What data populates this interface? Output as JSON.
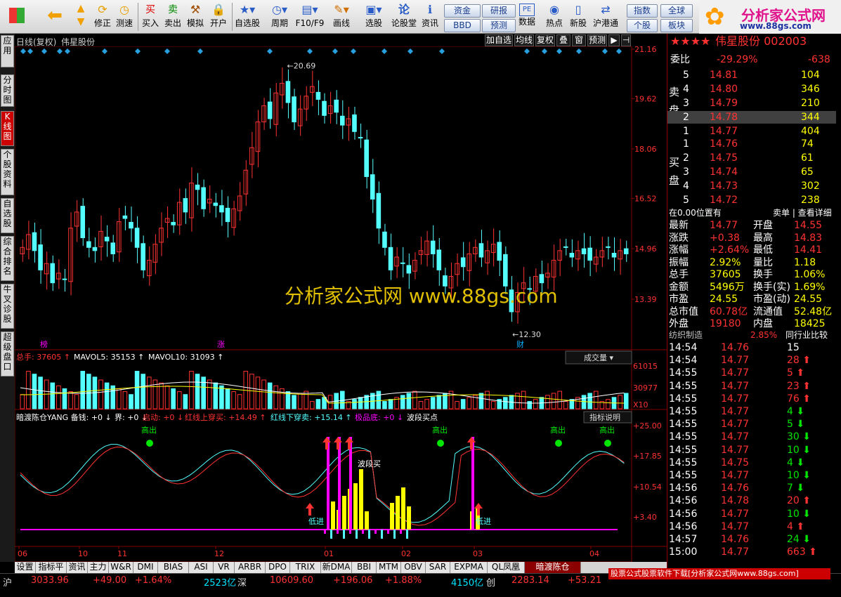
{
  "toolbar": {
    "items": [
      {
        "id": "buy",
        "label": "买入",
        "icon": "买"
      },
      {
        "id": "sell",
        "label": "卖出",
        "icon": "卖"
      },
      {
        "id": "sim",
        "label": "模拟",
        "icon": "hammer-icon"
      },
      {
        "id": "open",
        "label": "开户",
        "icon": "lock-icon"
      },
      {
        "id": "self",
        "label": "自选股",
        "icon": "star-icon"
      },
      {
        "id": "period",
        "label": "周期",
        "icon": "clock-icon"
      },
      {
        "id": "f10",
        "label": "F10/F9",
        "icon": "doc-icon"
      },
      {
        "id": "draw",
        "label": "画线",
        "icon": "pen-icon"
      },
      {
        "id": "pick",
        "label": "选股",
        "icon": "monitor-icon"
      },
      {
        "id": "forum",
        "label": "论股堂",
        "icon": "论"
      },
      {
        "id": "info",
        "label": "资讯",
        "icon": "info-icon"
      },
      {
        "id": "data",
        "label": "数据",
        "icon": "PE"
      },
      {
        "id": "hot",
        "label": "热点",
        "icon": "hot-icon"
      },
      {
        "id": "newstock",
        "label": "新股",
        "icon": "phone-icon"
      },
      {
        "id": "hk",
        "label": "沪港通",
        "icon": "hk-icon"
      }
    ],
    "nav": {
      "back": "back-icon",
      "fix": "修正",
      "speed": "测速"
    },
    "btns": {
      "fund": "资金",
      "report": "研报",
      "bbd": "BBD",
      "forecast": "预测",
      "index": "指数",
      "global": "全球",
      "stock": "个股",
      "sector": "板块"
    }
  },
  "logo": {
    "line1": "分析家公式网",
    "line2": "www.88gs.com"
  },
  "lefttabs": [
    "应用",
    "分时图",
    "K线图",
    "个股资料",
    "自选股",
    "综合排名",
    "牛叉诊股",
    "超级盘口"
  ],
  "chart": {
    "title": "日线(复权)",
    "name": "伟星股份",
    "buttons": [
      "加自选",
      "均线",
      "复权",
      "叠",
      "窗",
      "预测"
    ],
    "price_ticks": [
      "21.16",
      "19.62",
      "18.06",
      "16.52",
      "14.96",
      "13.39"
    ],
    "max_label": "20.69",
    "min_label": "12.30",
    "month_labels": [
      "06",
      "10",
      "11",
      "12",
      "01",
      "02",
      "03",
      "04"
    ],
    "markers": [
      "榜",
      "涨",
      "财"
    ],
    "volume": {
      "zongshou": "总手: 37605",
      "mavol5": "MAVOL5: 35153",
      "mavol10": "MAVOL10: 31093",
      "name": "成交量",
      "ticks": [
        "61015",
        "30977"
      ],
      "unit": "X10"
    },
    "indicator": {
      "name": "暗渡陈仓YANG",
      "label": "备钱: +0",
      "jie": "界: +0",
      "qidong": "启动: +0",
      "hongxian_up": "红线上穿买: +14.49",
      "hongxian_down": "红线下穿卖: +15.14",
      "jipin": "极品底: +0",
      "boduan": "波段买点",
      "btn": "指标说明",
      "ticks": [
        "+25.00",
        "+17.85",
        "+10.54",
        "+3.40"
      ],
      "gaochu": "高出",
      "dijin": "低进",
      "boduan_tag": "波段买"
    }
  },
  "chart_data": {
    "type": "candlestick",
    "price_axis": [
      12.3,
      21.16
    ],
    "max": 20.69,
    "min": 12.3,
    "closes": [
      15.0,
      15.4,
      14.9,
      14.3,
      14.5,
      13.9,
      14.2,
      14.0,
      15.6,
      16.1,
      15.3,
      15.0,
      14.9,
      15.5,
      15.2,
      14.8,
      15.8,
      15.9,
      15.6,
      15.0,
      14.3,
      14.6,
      15.1,
      15.6,
      15.9,
      15.7,
      16.4,
      16.1,
      17.0,
      16.8,
      16.2,
      16.5,
      16.3,
      16.1,
      15.8,
      16.2,
      16.6,
      17.4,
      18.1,
      18.9,
      19.4,
      19.0,
      19.8,
      20.1,
      19.5,
      18.9,
      19.3,
      19.7,
      20.0,
      19.6,
      19.1,
      19.4,
      19.2,
      18.8,
      19.0,
      18.6,
      18.4,
      17.2,
      16.5,
      15.6,
      15.0,
      14.3,
      14.7,
      14.5,
      14.2,
      14.6,
      14.9,
      15.2,
      14.8,
      14.3,
      13.8,
      14.1,
      14.5,
      14.4,
      14.8,
      15.0,
      14.7,
      14.9,
      15.1,
      14.6,
      13.8,
      13.0,
      13.6,
      13.9,
      13.7,
      14.1,
      13.9,
      14.2,
      14.6,
      14.9,
      15.0,
      14.7,
      14.9,
      14.8,
      14.6,
      14.7,
      14.9,
      15.0,
      14.7,
      14.9,
      14.8
    ],
    "volume_max": 61015
  },
  "rightpanel": {
    "title": "伟星股份",
    "code": "002003",
    "weibi": "委比",
    "weibi_val": "-29.29%",
    "weicha": "-638",
    "sell_label": "卖盘",
    "buy_label": "买盘",
    "sell": [
      {
        "n": "5",
        "p": "14.81",
        "v": "104"
      },
      {
        "n": "4",
        "p": "14.80",
        "v": "346"
      },
      {
        "n": "3",
        "p": "14.79",
        "v": "210"
      },
      {
        "n": "2",
        "p": "14.78",
        "v": "344"
      },
      {
        "n": "1",
        "p": "14.77",
        "v": "404"
      }
    ],
    "buy": [
      {
        "n": "1",
        "p": "14.76",
        "v": "74"
      },
      {
        "n": "2",
        "p": "14.75",
        "v": "61"
      },
      {
        "n": "3",
        "p": "14.74",
        "v": "65"
      },
      {
        "n": "4",
        "p": "14.73",
        "v": "302"
      },
      {
        "n": "5",
        "p": "14.72",
        "v": "238"
      }
    ],
    "pos": "在0.00位置有",
    "sellbtn": "卖单",
    "detail": "查看详细",
    "stats": [
      [
        "最新",
        "14.77",
        "开盘",
        "14.55"
      ],
      [
        "涨跌",
        "+0.38",
        "最高",
        "14.83"
      ],
      [
        "涨幅",
        "+2.64%",
        "最低",
        "14.41"
      ],
      [
        "振幅",
        "2.92%",
        "量比",
        "1.18"
      ],
      [
        "总手",
        "37605",
        "换手",
        "1.06%"
      ],
      [
        "金额",
        "5496万",
        "换手(实)",
        "1.69%"
      ],
      [
        "市盈",
        "24.55",
        "市盈(动)",
        "24.55"
      ],
      [
        "总市值",
        "60.78亿",
        "流通值",
        "52.48亿"
      ],
      [
        "外盘",
        "19180",
        "内盘",
        "18425"
      ]
    ],
    "industry": "纺织制造",
    "industry_pct": "2.85%",
    "compare": "同行业比较",
    "ticks": [
      [
        "14:54",
        "14.76",
        "15",
        "w"
      ],
      [
        "14:54",
        "14.77",
        "28",
        "u"
      ],
      [
        "14:55",
        "14.77",
        "5",
        "u"
      ],
      [
        "14:55",
        "14.77",
        "23",
        "u"
      ],
      [
        "14:55",
        "14.77",
        "76",
        "u"
      ],
      [
        "14:55",
        "14.77",
        "4",
        "d"
      ],
      [
        "14:55",
        "14.77",
        "5",
        "d"
      ],
      [
        "14:55",
        "14.77",
        "30",
        "d"
      ],
      [
        "14:55",
        "14.77",
        "10",
        "d"
      ],
      [
        "14:55",
        "14.75",
        "4",
        "d"
      ],
      [
        "14:55",
        "14.77",
        "10",
        "d"
      ],
      [
        "14:56",
        "14.76",
        "7",
        "d"
      ],
      [
        "14:56",
        "14.78",
        "20",
        "u"
      ],
      [
        "14:56",
        "14.77",
        "10",
        "d"
      ],
      [
        "14:56",
        "14.77",
        "4",
        "u"
      ],
      [
        "14:57",
        "14.76",
        "24",
        "d"
      ],
      [
        "15:00",
        "14.77",
        "663",
        "u"
      ]
    ]
  },
  "bottomtabs": [
    "设置",
    "指标平台",
    "资讯",
    "主力",
    "W&R",
    "DMI",
    "BIAS",
    "ASI",
    "VR",
    "ARBR",
    "DPO",
    "TRIX",
    "新DMA",
    "BBI",
    "MTM",
    "OBV",
    "SAR",
    "EXPMA",
    "QL凤凰线",
    "暗渡陈仓YANG"
  ],
  "status": {
    "sh": "沪",
    "sh_val": "3033.96",
    "sh_chg": "+49.00",
    "sh_pct": "+1.64%",
    "sh_amt": "2523亿",
    "sz": "深",
    "sz_val": "10609.60",
    "sz_chg": "+196.06",
    "sz_pct": "+1.88%",
    "sz_amt": "4150亿",
    "cy": "创",
    "cy_val": "2283.14",
    "cy_chg": "+53.21",
    "ad": "股票公式股票软件下载[分析家公式网www.88gs.com]"
  },
  "watermark": "分析家公式网 www.88gs.com"
}
